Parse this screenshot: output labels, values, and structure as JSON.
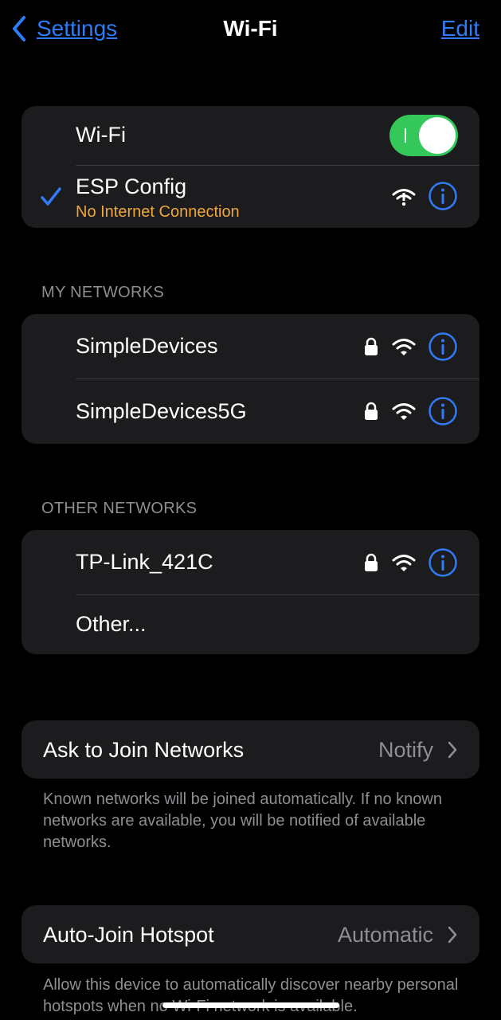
{
  "nav": {
    "back_label": "Settings",
    "title": "Wi-Fi",
    "edit_label": "Edit"
  },
  "current": {
    "wifi_label": "Wi-Fi",
    "wifi_enabled": true,
    "connected_network": "ESP Config",
    "connected_status": "No Internet Connection"
  },
  "my_networks": {
    "header": "MY NETWORKS",
    "items": [
      {
        "name": "SimpleDevices",
        "secured": true
      },
      {
        "name": "SimpleDevices5G",
        "secured": true
      }
    ]
  },
  "other_networks": {
    "header": "OTHER NETWORKS",
    "items": [
      {
        "name": "TP-Link_421C",
        "secured": true
      }
    ],
    "other_label": "Other..."
  },
  "ask_to_join": {
    "label": "Ask to Join Networks",
    "value": "Notify",
    "footnote": "Known networks will be joined automatically. If no known networks are available, you will be notified of available networks."
  },
  "auto_join": {
    "label": "Auto-Join Hotspot",
    "value": "Automatic",
    "footnote": "Allow this device to automatically discover nearby personal hotspots when no Wi-Fi network is available."
  },
  "colors": {
    "accent": "#2f7cf6",
    "toggle_on": "#34c759",
    "warning": "#f0a63a",
    "group_bg": "#1c1c1e",
    "secondary_text": "#8e8e93"
  },
  "icons": {
    "back": "chevron-left-icon",
    "check": "checkmark-icon",
    "info": "info-circle-icon",
    "wifi": "wifi-icon",
    "wifi_no_internet": "wifi-exclamation-icon",
    "lock": "lock-icon",
    "chevron": "chevron-right-icon"
  }
}
